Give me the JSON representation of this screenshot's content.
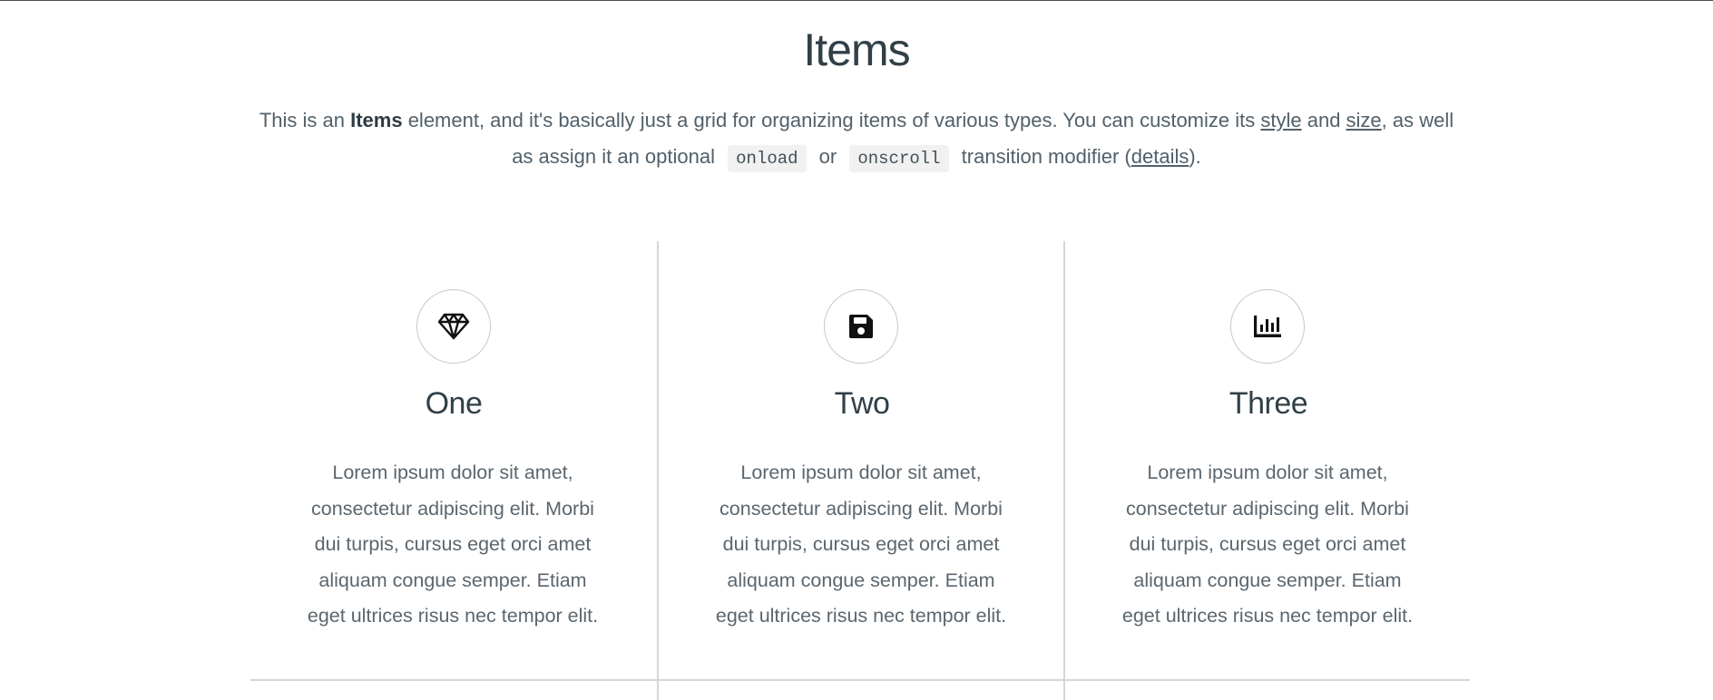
{
  "page": {
    "title": "Items"
  },
  "intro": {
    "text_1": "This is an ",
    "strong": "Items",
    "text_2": " element, and it's basically just a grid for organizing items of various types. You can customize its ",
    "link_style": "style",
    "text_3": " and ",
    "link_size": "size",
    "text_4": ", as well as assign it an optional ",
    "code_onload": "onload",
    "text_5": " or ",
    "code_onscroll": "onscroll",
    "text_6": " transition modifier (",
    "link_details": "details",
    "text_7": ")."
  },
  "items": [
    {
      "icon": "gem-icon",
      "title": "One",
      "text": "Lorem ipsum dolor sit amet, consectetur adipiscing elit. Morbi dui turpis, cursus eget orci amet aliquam congue semper. Etiam eget ultrices risus nec tempor elit."
    },
    {
      "icon": "save-icon",
      "title": "Two",
      "text": "Lorem ipsum dolor sit amet, consectetur adipiscing elit. Morbi dui turpis, cursus eget orci amet aliquam congue semper. Etiam eget ultrices risus nec tempor elit."
    },
    {
      "icon": "chart-bar-icon",
      "title": "Three",
      "text": "Lorem ipsum dolor sit amet, consectetur adipiscing elit. Morbi dui turpis, cursus eget orci amet aliquam congue semper. Etiam eget ultrices risus nec tempor elit."
    }
  ],
  "colors": {
    "heading": "#313f47",
    "body_text": "#5b666e",
    "divider": "#d6d6d6",
    "code_background": "#f1f1f1"
  }
}
